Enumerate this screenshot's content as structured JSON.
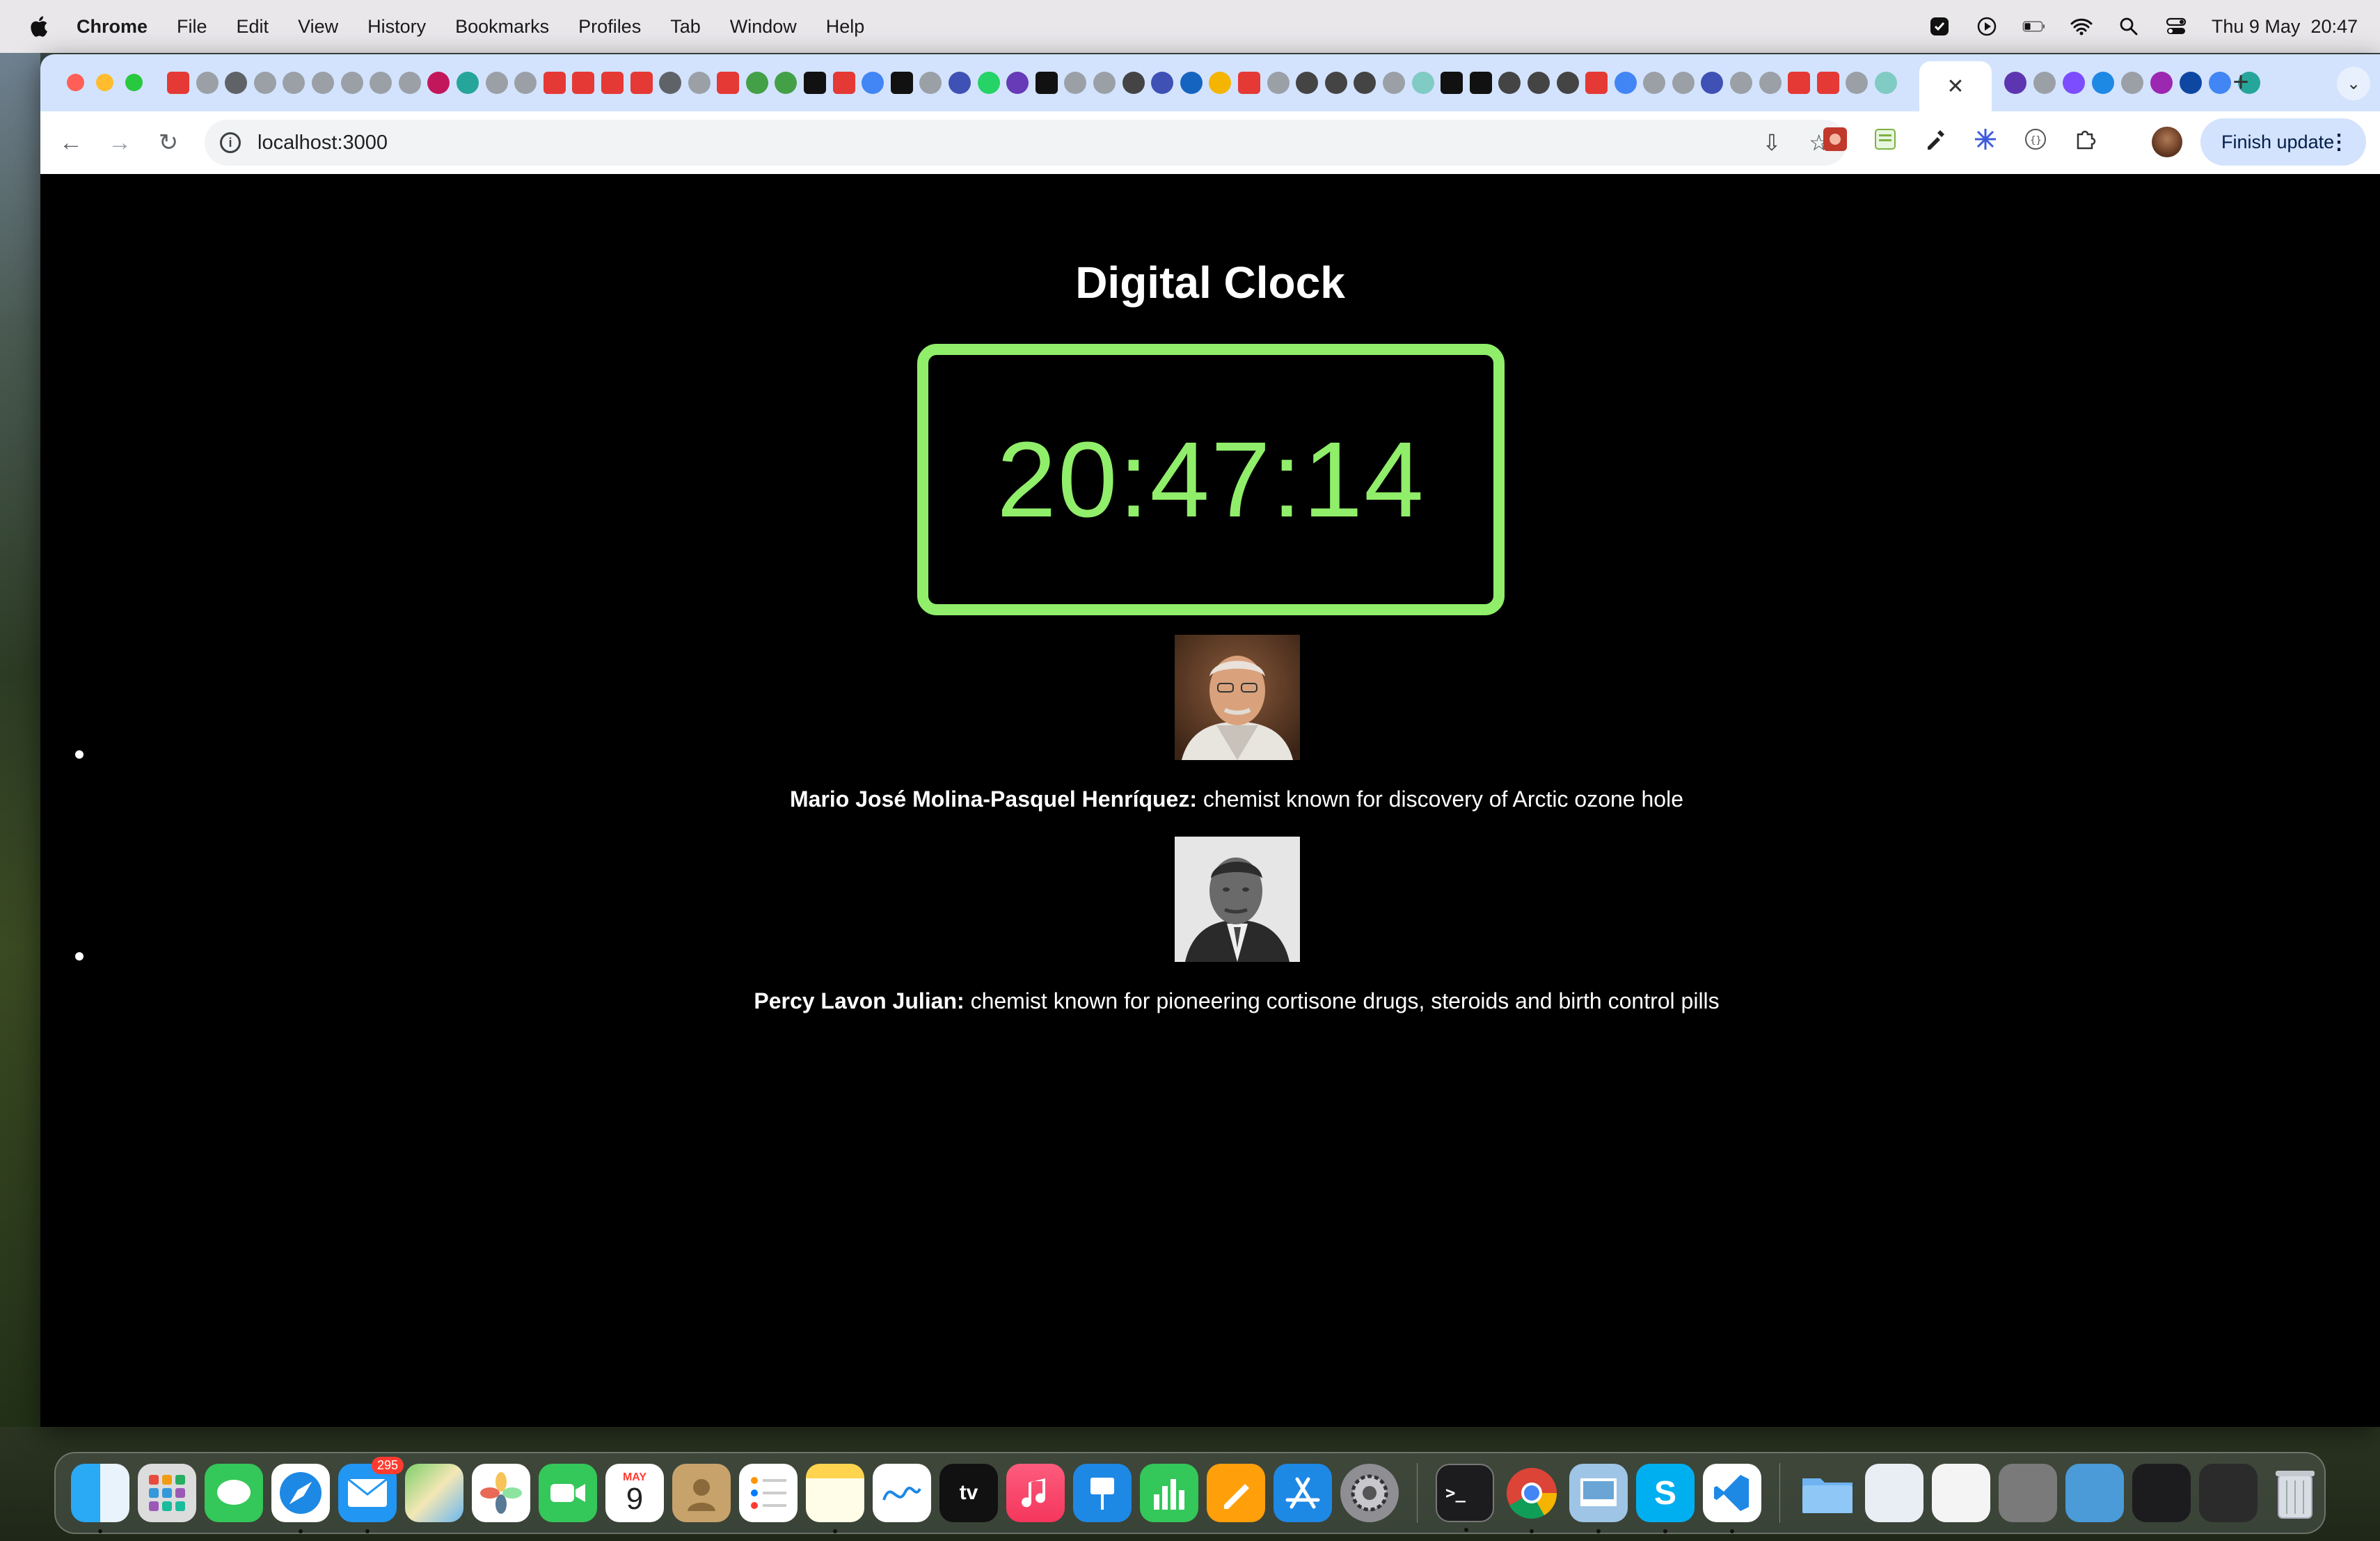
{
  "menubar": {
    "app": "Chrome",
    "items": [
      "File",
      "Edit",
      "View",
      "History",
      "Bookmarks",
      "Profiles",
      "Tab",
      "Window",
      "Help"
    ],
    "datetime": "Thu 9 May  20:47"
  },
  "browser": {
    "url": "localhost:3000",
    "finish_update": "Finish update",
    "close_tab": "✕",
    "new_tab": "+"
  },
  "page": {
    "title": "Digital Clock",
    "time": "20:47:14",
    "clock_color": "#90ee6a",
    "scientists": [
      {
        "name": "Mario José Molina-Pasquel Henríquez:",
        "description": " chemist known for discovery of Arctic ozone hole"
      },
      {
        "name": "Percy Lavon Julian:",
        "description": " chemist known for pioneering cortisone drugs, steroids and birth control pills"
      }
    ]
  },
  "dock": {
    "mail_badge": "295",
    "calendar_month": "MAY",
    "calendar_day": "9",
    "tv_label": "tv"
  }
}
